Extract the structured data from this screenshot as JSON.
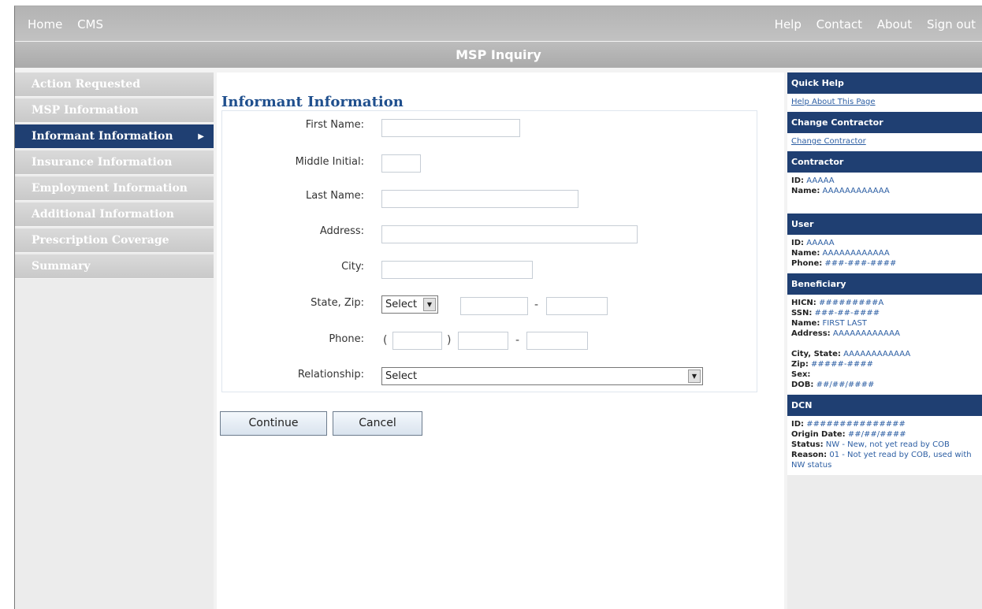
{
  "topnav": {
    "home": "Home",
    "cms": "CMS",
    "help": "Help",
    "contact": "Contact",
    "about": "About",
    "signout": "Sign out"
  },
  "title": "MSP Inquiry",
  "leftnav": [
    {
      "label": "Action Requested"
    },
    {
      "label": "MSP Information"
    },
    {
      "label": "Informant Information",
      "active": true
    },
    {
      "label": "Insurance Information"
    },
    {
      "label": "Employment Information"
    },
    {
      "label": "Additional Information"
    },
    {
      "label": "Prescription Coverage"
    },
    {
      "label": "Summary"
    }
  ],
  "form": {
    "title": "Informant Information",
    "first_name": "First Name:",
    "middle_initial": "Middle Initial:",
    "last_name": "Last Name:",
    "address": "Address:",
    "city": "City:",
    "state_zip": "State, Zip:",
    "state_select": "Select",
    "phone": "Phone:",
    "relationship": "Relationship:",
    "relationship_select": "Select",
    "dash": "-",
    "lparen": "(",
    "rparen": ")"
  },
  "buttons": {
    "continue": "Continue",
    "cancel": "Cancel"
  },
  "right": {
    "quick_help": "Quick Help",
    "help_link": "Help About This Page",
    "change_contractor_h": "Change Contractor",
    "change_contractor_link": "Change Contractor",
    "contractor_h": "Contractor",
    "contractor_id_l": "ID:",
    "contractor_id": "AAAAA",
    "contractor_name_l": "Name:",
    "contractor_name": "AAAAAAAAAAAA",
    "user_h": "User",
    "user_id_l": "ID:",
    "user_id": "AAAAA",
    "user_name_l": "Name:",
    "user_name": "AAAAAAAAAAAA",
    "user_phone_l": "Phone:",
    "user_phone": "###-###-####",
    "bene_h": "Beneficiary",
    "hicn_l": "HICN:",
    "hicn": "#########A",
    "ssn_l": "SSN:",
    "ssn": "###-##-####",
    "bname_l": "Name:",
    "bname": "FIRST LAST",
    "addr_l": "Address:",
    "addr": "AAAAAAAAAAAA",
    "citystate_l": "City, State:",
    "citystate": "AAAAAAAAAAAA",
    "zip_l": "Zip:",
    "zip": "#####-####",
    "sex_l": "Sex:",
    "sex": "",
    "dob_l": "DOB:",
    "dob": "##/##/####",
    "dcn_h": "DCN",
    "dcn_id_l": "ID:",
    "dcn_id": "###############",
    "origin_l": "Origin Date:",
    "origin": "##/##/####",
    "status_l": "Status:",
    "status": "NW - New, not yet read by COB",
    "reason_l": "Reason:",
    "reason": "01 - Not yet read by COB, used with NW status"
  }
}
